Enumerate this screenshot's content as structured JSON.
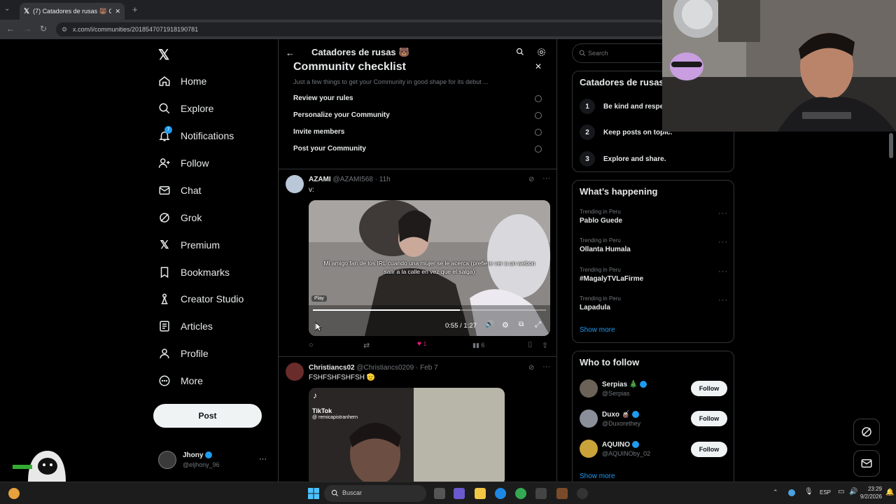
{
  "browser": {
    "tab_title": "(7) Catadores de rusas 🐻 Com",
    "url": "x.com/i/communities/2018547071918190781"
  },
  "nav": {
    "items": [
      {
        "label": "Home",
        "icon": "home-icon"
      },
      {
        "label": "Explore",
        "icon": "search-icon"
      },
      {
        "label": "Notifications",
        "icon": "bell-icon",
        "badge": "7"
      },
      {
        "label": "Follow",
        "icon": "add-person-icon"
      },
      {
        "label": "Chat",
        "icon": "mail-icon"
      },
      {
        "label": "Grok",
        "icon": "grok-icon"
      },
      {
        "label": "Premium",
        "icon": "x-logo-icon"
      },
      {
        "label": "Bookmarks",
        "icon": "bookmark-icon"
      },
      {
        "label": "Creator Studio",
        "icon": "creator-icon"
      },
      {
        "label": "Articles",
        "icon": "article-icon"
      },
      {
        "label": "Profile",
        "icon": "person-icon"
      },
      {
        "label": "More",
        "icon": "more-circle-icon"
      }
    ],
    "post_label": "Post",
    "account": {
      "name": "Jhony",
      "handle": "@eljhony_96",
      "more": "···"
    }
  },
  "header": {
    "title": "Catadores de rusas 🐻"
  },
  "checklist": {
    "title": "Community checklist",
    "subtitle": "Just a few things to get your Community in good shape for its debut ...",
    "items": [
      "Review your rules",
      "Personalize your Community",
      "Invite members",
      "Post your Community"
    ]
  },
  "post1": {
    "author": "AZAMI",
    "handle": "@AZAMI568",
    "time": "· 11h",
    "text": "v:",
    "caption": "Mi amigo fan de los IRL cuando una mujer se le acerca (prefiere ver a un webon salir a la calle en vez que el salga)",
    "play_tooltip": "Play",
    "time_display": "0:55 / 1:27",
    "progress": 0.63,
    "likes": "1",
    "views": "6"
  },
  "post2": {
    "author": "Christiancs02",
    "handle": "@Christiancs0209",
    "time": "· Feb 7",
    "text": "FSHFSHFSHFSH 🫡",
    "tiktok_label": "TikTok",
    "tiktok_user": "@ remicapistranhern"
  },
  "right": {
    "search_placeholder": "Search",
    "community_title": "Catadores de rusas",
    "rules": [
      "Be kind and respec",
      "Keep posts on topic.",
      "Explore and share."
    ],
    "happening_title": "What’s happening",
    "trends": [
      {
        "context": "Trending in Peru",
        "name": "Pablo Guede"
      },
      {
        "context": "Trending in Peru",
        "name": "Ollanta Humala"
      },
      {
        "context": "Trending in Peru",
        "name": "#MagalyTVLaFirme"
      },
      {
        "context": "Trending in Peru",
        "name": "Lapadula"
      }
    ],
    "show_more": "Show more",
    "wtf_title": "Who to follow",
    "follow_label": "Follow",
    "accounts": [
      {
        "name": "Serpias 🎄",
        "handle": "@Serpias"
      },
      {
        "name": "Duxo 🧉",
        "handle": "@Duxorethey"
      },
      {
        "name": "AQUINO",
        "handle": "@AQUINOby_02"
      }
    ]
  },
  "taskbar": {
    "search_label": "Buscar",
    "lang": "ESP",
    "time": "23:29",
    "date": "9/2/2026"
  },
  "colors": {
    "accent": "#1d9bf0",
    "like": "#f91880",
    "bg": "#000000",
    "border": "#2f3336"
  }
}
